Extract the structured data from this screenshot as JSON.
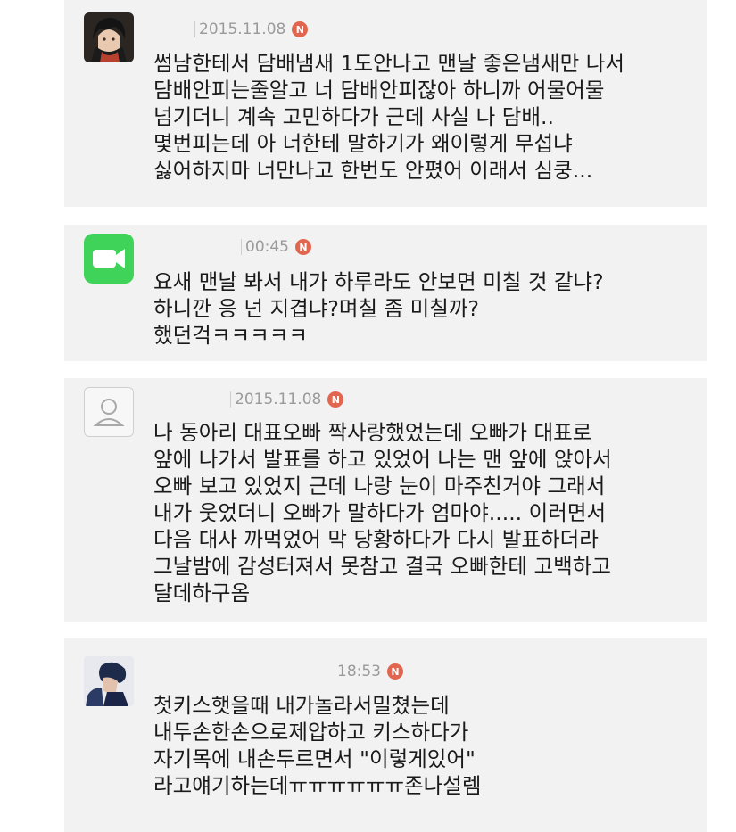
{
  "comments": [
    {
      "avatar": "anime-character-avatar",
      "timestamp": "2015.11.08",
      "badge": "N",
      "lines": [
        "썸남한테서 담배냄새 1도안나고 맨날 좋은냄새만 나서",
        "담배안피는줄알고 너 담배안피잖아 하니까 어물어물",
        "넘기더니 계속 고민하다가 근데 사실 나 담배..",
        "몇번피는데 아 너한테 말하기가 왜이렇게 무섭냐",
        "싫어하지마 너만나고 한번도 안폈어 이래서 심쿵..."
      ]
    },
    {
      "avatar": "facetime-video-icon",
      "timestamp": "00:45",
      "badge": "N",
      "lines": [
        "요새 맨날 봐서 내가 하루라도 안보면 미칠 것 같냐?",
        "하니깐 응 넌 지겹냐?며칠 좀 미칠까?",
        "했던걱ㅋㅋㅋㅋㅋ"
      ]
    },
    {
      "avatar": "default-person-icon",
      "timestamp": "2015.11.08",
      "badge": "N",
      "lines": [
        "나 동아리 대표오빠 짝사랑했었는데 오빠가 대표로",
        "앞에 나가서 발표를 하고 있었어 나는 맨 앞에 앉아서",
        "오빠 보고 있었지 근데 나랑 눈이 마주친거야 그래서",
        "내가 웃었더니 오빠가 말하다가 엄마야..... 이러면서",
        "다음 대사 까먹었어 막 당황하다가 다시 발표하더라",
        "그날밤에 감성터져서 못참고 결국 오빠한테 고백하고",
        "달데하구옴"
      ]
    },
    {
      "avatar": "person-photo-avatar",
      "timestamp": "18:53",
      "badge": "N",
      "lines": [
        "첫키스햇을때 내가놀라서밀쳤는데",
        "내두손한손으로제압하고 키스하다가",
        "자기목에 내손두르면서 \"이렇게있어\"",
        "라고얘기하는데ㅠㅠㅠㅠㅠㅠ존나설렘"
      ]
    }
  ]
}
